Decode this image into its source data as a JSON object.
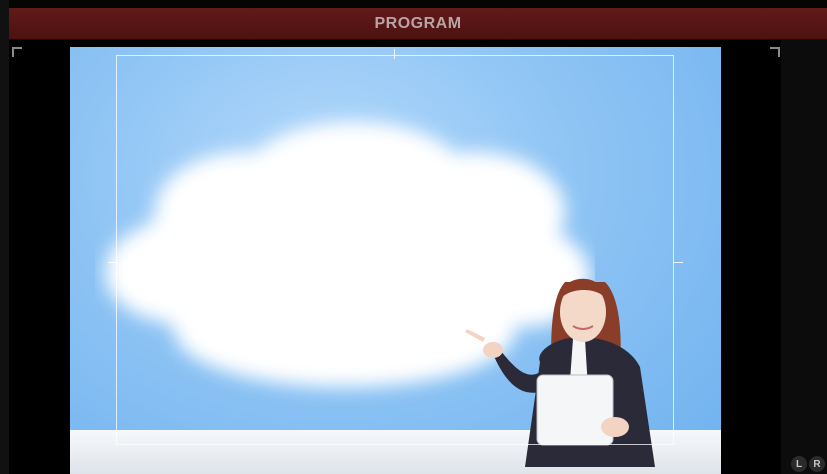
{
  "header": {
    "title": "PROGRAM"
  },
  "audio": {
    "left_label": "L",
    "right_label": "R"
  },
  "colors": {
    "program_bar": "#5a1616",
    "sky": "#8ec4f4",
    "background": "#0a0a0a"
  }
}
